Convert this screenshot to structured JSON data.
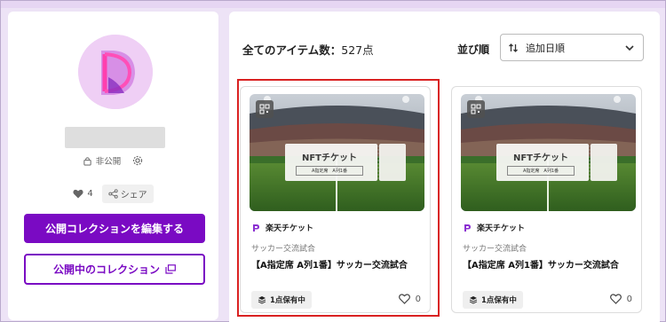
{
  "profile": {
    "privacy_label": "非公開",
    "likes_count": "4",
    "share_label": "シェア",
    "edit_button_label": "公開コレクションを編集する",
    "public_button_label": "公開中のコレクション"
  },
  "items_header": {
    "count_label": "全てのアイテム数：",
    "count_value": "527点",
    "sort_label": "並び順",
    "sort_value": "追加日順"
  },
  "cards": [
    {
      "ticket_title": "NFTチケット",
      "ticket_sub": "A指定席　A列1番",
      "issuer": "楽天チケット",
      "category": "サッカー交流試合",
      "title": "【A指定席 A列1番】サッカー交流試合",
      "owned_label": "1点保有中",
      "favorites": "0",
      "selected": true
    },
    {
      "ticket_title": "NFTチケット",
      "ticket_sub": "A指定席　A列1番",
      "issuer": "楽天チケット",
      "category": "サッカー交流試合",
      "title": "【A指定席 A列1番】サッカー交流試合",
      "owned_label": "1点保有中",
      "favorites": "0",
      "selected": false
    }
  ],
  "colors": {
    "accent": "#7a0ac3",
    "highlight": "#d92121",
    "background": "#ede3f6"
  }
}
